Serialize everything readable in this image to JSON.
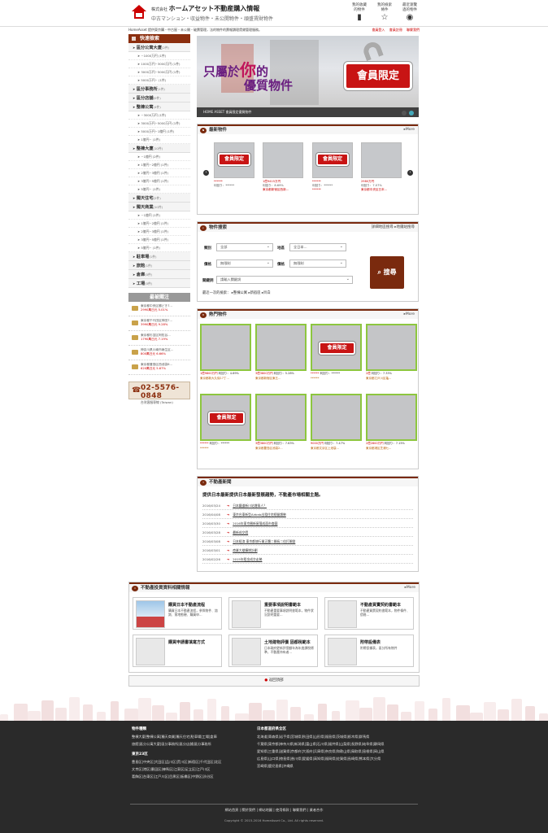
{
  "header": {
    "company_small": "株式会社",
    "company_name": "ホームアセット不動産購入情報",
    "tagline": "中古マンション・収益物件・未公開物件・頑盛賃財物件",
    "nav": [
      {
        "label": "我的收藏\n的物件",
        "icon": "book-icon"
      },
      {
        "label": "我的檢索\n條件",
        "icon": "star-icon"
      },
      {
        "label": "最近瀏覽\n過的物件",
        "icon": "eye-icon"
      }
    ]
  },
  "subbar": {
    "left": "HomeAsset 提供東京購・中古屋・未公開・破賣管理，法的物件的賣報讚理賃貸管理服務。",
    "links": [
      "會員登入",
      "會員註冊",
      "聯繫我們"
    ]
  },
  "sidebar": {
    "title": "快速檢索",
    "groups": [
      {
        "name": "區分公寓大廈",
        "count": "(2件)",
        "subs": [
          "~1000万円 (1件)",
          "1000万円~3000万円 (1件)",
          "3000万円~5000万円 (1件)",
          "5000万円~ (1件)"
        ]
      },
      {
        "name": "區分事務所",
        "count": "(1件)",
        "subs": []
      },
      {
        "name": "區分店舖",
        "count": "(0件)",
        "subs": []
      },
      {
        "name": "整棟公寓",
        "count": "(4件)",
        "subs": [
          "~3000万円 (1件)",
          "3000万円~5000万円 (1件)",
          "5000万円~1億円 (1件)",
          "1億円~ (1件)"
        ]
      },
      {
        "name": "整棟大廈",
        "count": "(10件)",
        "subs": [
          "~1億円 (2件)",
          "1億円~2億円 (1件)",
          "2億円~3億円 (1件)",
          "3億円~5億円 (1件)",
          "5億円~ (1件)"
        ]
      },
      {
        "name": "獨天住宅",
        "count": "(2件)",
        "subs": []
      },
      {
        "name": "獨天商業",
        "count": "(10件)",
        "subs": [
          "~1億円 (1件)",
          "1億円~2億円 (1件)",
          "2億円~3億円 (1件)",
          "3億円~5億円 (1件)",
          "5億円~ (1件)"
        ]
      },
      {
        "name": "駐車場",
        "count": "(1件)",
        "subs": []
      },
      {
        "name": "旅館",
        "count": "(1件)",
        "subs": []
      },
      {
        "name": "倉庫",
        "count": "(0件)",
        "subs": []
      },
      {
        "name": "工場",
        "count": "(0件)",
        "subs": []
      }
    ],
    "fav_title": "最被關注",
    "favs": [
      {
        "t": "東京都中央区勝どき7...",
        "p": "2990萬日元 5.01%"
      },
      {
        "t": "東京都千代田区神田7...",
        "p": "3990萬日元 9.28%"
      },
      {
        "t": "東京都杉並区阿佐谷...",
        "p": "1790萬日元 7.19%"
      },
      {
        "t": "神奈川県川崎市麻生区...",
        "p": "800萬日元 6.66%"
      },
      {
        "t": "東京都豊島区西池袋6...",
        "p": "620萬日元 5.67%"
      }
    ],
    "phone": "02-5576-0848",
    "phone_sub": "台灣客服專線 (Taiwan)"
  },
  "banner": {
    "line1a": "只屬於",
    "line1b": "你",
    "line1c": "的",
    "line2": "優質物件",
    "lock_label": "會員限定",
    "bar_text": "HOME ASSET     會員限定優質物件"
  },
  "new_props": {
    "title": "最新物件",
    "more": "More",
    "cards": [
      {
        "l1": "******",
        "l2": "利回り：******",
        "l3": "",
        "badge": true
      },
      {
        "l1": "1億9415万円",
        "l2": "利回り：8.69%",
        "l3": "東京都新宿区西新...",
        "badge": false
      },
      {
        "l1": "******",
        "l2": "利回り：******",
        "l3": "******",
        "badge": true
      },
      {
        "l1": "2980万円",
        "l2": "利回り：7.07%",
        "l3": "東京都中央区日本...",
        "badge": false
      }
    ]
  },
  "search": {
    "title": "物件搜索",
    "links": [
      "詳細地區搜尋",
      "地鐵站搜尋"
    ],
    "f_type": "類別",
    "v_type": "全部",
    "f_area": "地區",
    "v_area": "全日本...",
    "f_price": "價格",
    "v_price_min": "無限制",
    "f_price2": "價格",
    "v_price_max": "無限制",
    "f_kw": "關鍵詞",
    "v_kw": "請輸入關鍵詞",
    "button": "搜尋",
    "recent_label": "最近一次的檢索：",
    "recent": [
      "整棟公寓",
      "新宿區",
      "目白"
    ]
  },
  "hot": {
    "title": "熱門物件",
    "more": "More",
    "cards": [
      {
        "p": "1億9800万円",
        "y": "利回り：4.69%",
        "a": "東京都新大久保17丁...",
        "badge": false
      },
      {
        "p": "3億3800万円",
        "y": "利回り：5.28%",
        "a": "東京都新宿区東五...",
        "badge": false
      },
      {
        "p": "******",
        "y": "利回り：******",
        "a": "******",
        "badge": true
      },
      {
        "p": "2億",
        "y": "利回り：7.33%",
        "a": "東京都江戸川区亀...",
        "badge": false
      },
      {
        "p": "******",
        "y": "利回り：******",
        "a": "******",
        "badge": true
      },
      {
        "p": "3億3800万円",
        "y": "利回り：7.63%",
        "a": "東京都豊島区池袋2...",
        "badge": false
      },
      {
        "p": "9000万円",
        "y": "利回り：7.47%",
        "a": "東京都文京区上池袋...",
        "badge": false
      },
      {
        "p": "2億2800万円",
        "y": "利回り：7.15%",
        "a": "東京都港区芝浦七...",
        "badge": false
      }
    ]
  },
  "news": {
    "title": "不動產新聞",
    "headline": "提供日本最新提供日本最新發展趨勢，不動產市場相關主題。",
    "rows": [
      {
        "d": "2016/03/24",
        "t": "日本鐵道新川站增乘人？"
      },
      {
        "d": "2016/04/08",
        "t": "東京台東新型Airbnb出租住宅經營趨勢"
      },
      {
        "d": "2016/03/30",
        "t": "2016年東京圈新屋落成面市查圖"
      },
      {
        "d": "2016/03/28",
        "t": "最新成交價"
      },
      {
        "d": "2016/03/08",
        "t": "日本經濟 東京都旅行業正體二開長二倍打開發"
      },
      {
        "d": "2016/03/01",
        "t": "商業大樓擴增計劃"
      },
      {
        "d": "2016/02/26",
        "t": "2015年租金成交走勢"
      }
    ]
  },
  "invest": {
    "title": "不動產投資資料相關情報",
    "more": "More",
    "docs": [
      {
        "t": "購買日本不動產流程",
        "d": "購買日本不動產流程，參與物件、諮詢、實地勘驗、購買申..."
      },
      {
        "t": "重要事項說明書範本",
        "d": "不動產重要事項說明書範本，物件狀況說明重要..."
      },
      {
        "t": "不動產買賣契約書範本",
        "d": "不動產買賣契約書範本，物件條件、價格..."
      },
      {
        "t": "購買申請書填寫方式",
        "d": ""
      },
      {
        "t": "土地建物評價 固都稅範本",
        "d": "日本政府更新評價額年為年度課稅標準，不動產持有者..."
      },
      {
        "t": "附帶設備表",
        "d": "附帶設備表，區分所有物件"
      }
    ]
  },
  "backtop": "返回頂部",
  "footer": {
    "c1_title": "物件種類",
    "c1_lines": [
      "整棟大廈|整棟公寓|獨天商業|獨天住宅|駐車場|工場|倉庫",
      "旅館|區分公寓大廈|區分事務所|區分店舖|區分事務所"
    ],
    "c1b_title": "東京23区",
    "c1b_lines": [
      "豊島区|中央区|大田区|品川区|荒川区|新宿区|千代田区|北区",
      "文京区|港区|墨田区|練馬区|江東区|足立区|江戸川区",
      "葛飾区|台東区|江戸川区|目黒区|板橋区|中野区|渋谷区"
    ],
    "c2_title": "日本都道府県全区",
    "c2_lines": [
      "北海道|青森県|岩手県|宮城県|秋田県|山形県|福島県|茨城県|栃木県|群馬県",
      "千葉県|東京都|神奈川県|新潟県|富山県|石川県|福井県|山梨県|長野県|岐阜県|静岡県",
      "愛知県|三重県|滋賀県|京都府|大阪府|兵庫県|奈良県|和歌山県|鳥取県|島根県|岡山県",
      "広島県|山口県|徳島県|香川県|愛媛県|高知県|福岡県|佐賀県|長崎県|熊本県|大分県",
      "宮崎県|鹿児島県|沖縄県"
    ],
    "links": "網站首頁 | 關於我們 | 網站地圖 | 使用條款 | 聯繫我們 | 業者合作",
    "copy": "Copyright © 2015-2016 HomeAsset Co., Ltd. All rights reserved."
  }
}
